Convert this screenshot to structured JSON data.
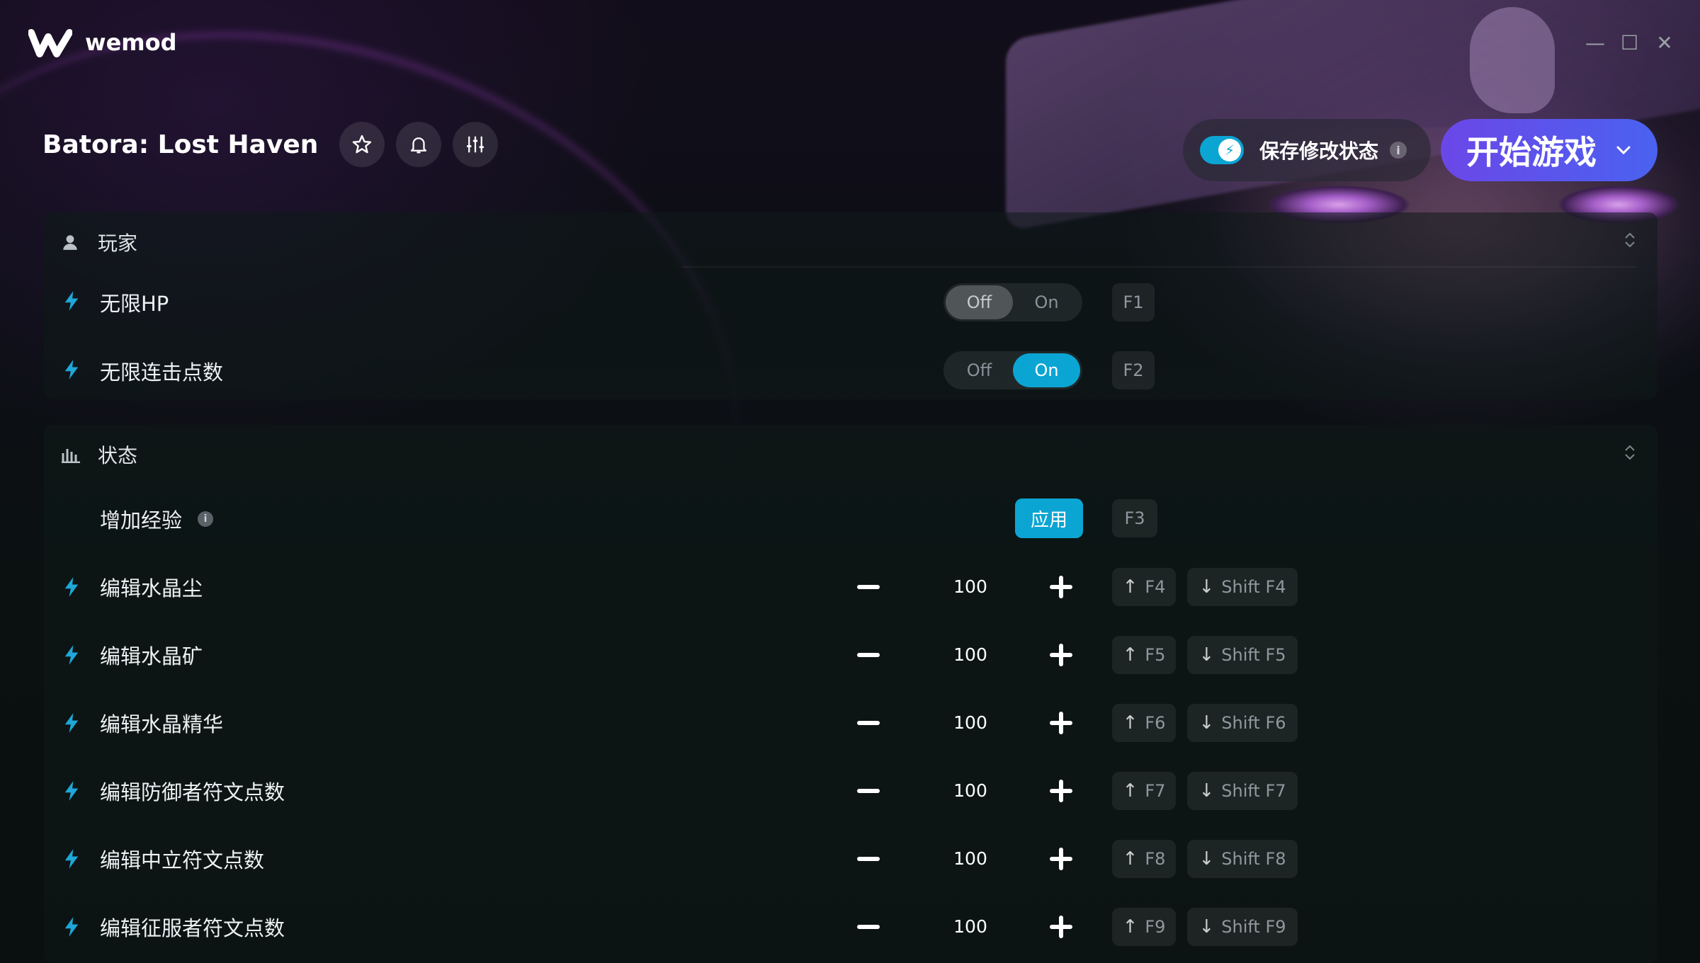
{
  "app": {
    "name": "wemod"
  },
  "window_controls": [
    "minimize",
    "maximize",
    "close"
  ],
  "game": {
    "title": "Batora: Lost Haven"
  },
  "header_buttons": [
    {
      "name": "favorite",
      "icon": "star-icon"
    },
    {
      "name": "notifications",
      "icon": "bell-icon"
    },
    {
      "name": "settings",
      "icon": "sliders-icon"
    }
  ],
  "save_mods": {
    "label": "保存修改状态",
    "enabled": true,
    "info": "i"
  },
  "play": {
    "label": "开始游戏"
  },
  "toggle_labels": {
    "off": "Off",
    "on": "On"
  },
  "sections": {
    "player": {
      "title": "玩家",
      "items": [
        {
          "label": "无限HP",
          "state": "Off",
          "hotkey": "F1"
        },
        {
          "label": "无限连击点数",
          "state": "On",
          "hotkey": "F2"
        }
      ]
    },
    "stats": {
      "title": "状态",
      "apply_item": {
        "label": "增加经验",
        "info": "i",
        "button": "应用",
        "hotkey": "F3"
      },
      "items": [
        {
          "label": "编辑水晶尘",
          "value": "100",
          "inc": "F4",
          "dec": "Shift F4"
        },
        {
          "label": "编辑水晶矿",
          "value": "100",
          "inc": "F5",
          "dec": "Shift F5"
        },
        {
          "label": "编辑水晶精华",
          "value": "100",
          "inc": "F6",
          "dec": "Shift F6"
        },
        {
          "label": "编辑防御者符文点数",
          "value": "100",
          "inc": "F7",
          "dec": "Shift F7"
        },
        {
          "label": "编辑中立符文点数",
          "value": "100",
          "inc": "F8",
          "dec": "Shift F8"
        },
        {
          "label": "编辑征服者符文点数",
          "value": "100",
          "inc": "F9",
          "dec": "Shift F9"
        }
      ]
    }
  },
  "colors": {
    "accent": "#0ba5d3",
    "play_start": "#6b47e8",
    "play_end": "#4a62f0",
    "bolt": "#1ea7d8"
  }
}
